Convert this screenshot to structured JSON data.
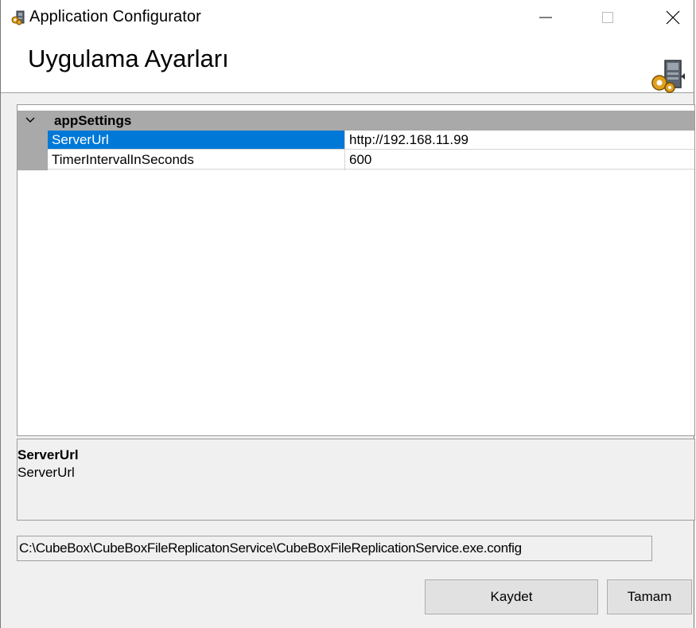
{
  "window": {
    "title": "Application Configurator",
    "icon": "app-config-icon",
    "controls": [
      "minimize-icon",
      "maximize-icon",
      "close-icon"
    ]
  },
  "header": {
    "title": "Uygulama Ayarları",
    "icon": "app-config-icon"
  },
  "grid": {
    "category": "appSettings",
    "rows": [
      {
        "name": "ServerUrl",
        "value": "http://192.168.11.99",
        "selected": true
      },
      {
        "name": "TimerIntervalInSeconds",
        "value": "600",
        "selected": false
      }
    ]
  },
  "description": {
    "title": "ServerUrl",
    "text": "ServerUrl"
  },
  "config_path": "C:\\CubeBox\\CubeBoxFileReplicatonService\\CubeBoxFileReplicationService.exe.config",
  "buttons": {
    "save": "Kaydet",
    "ok": "Tamam"
  },
  "colors": {
    "selection": "#0078d7",
    "category_bg": "#a9a9a9",
    "window_bg": "#f0f0f0"
  }
}
